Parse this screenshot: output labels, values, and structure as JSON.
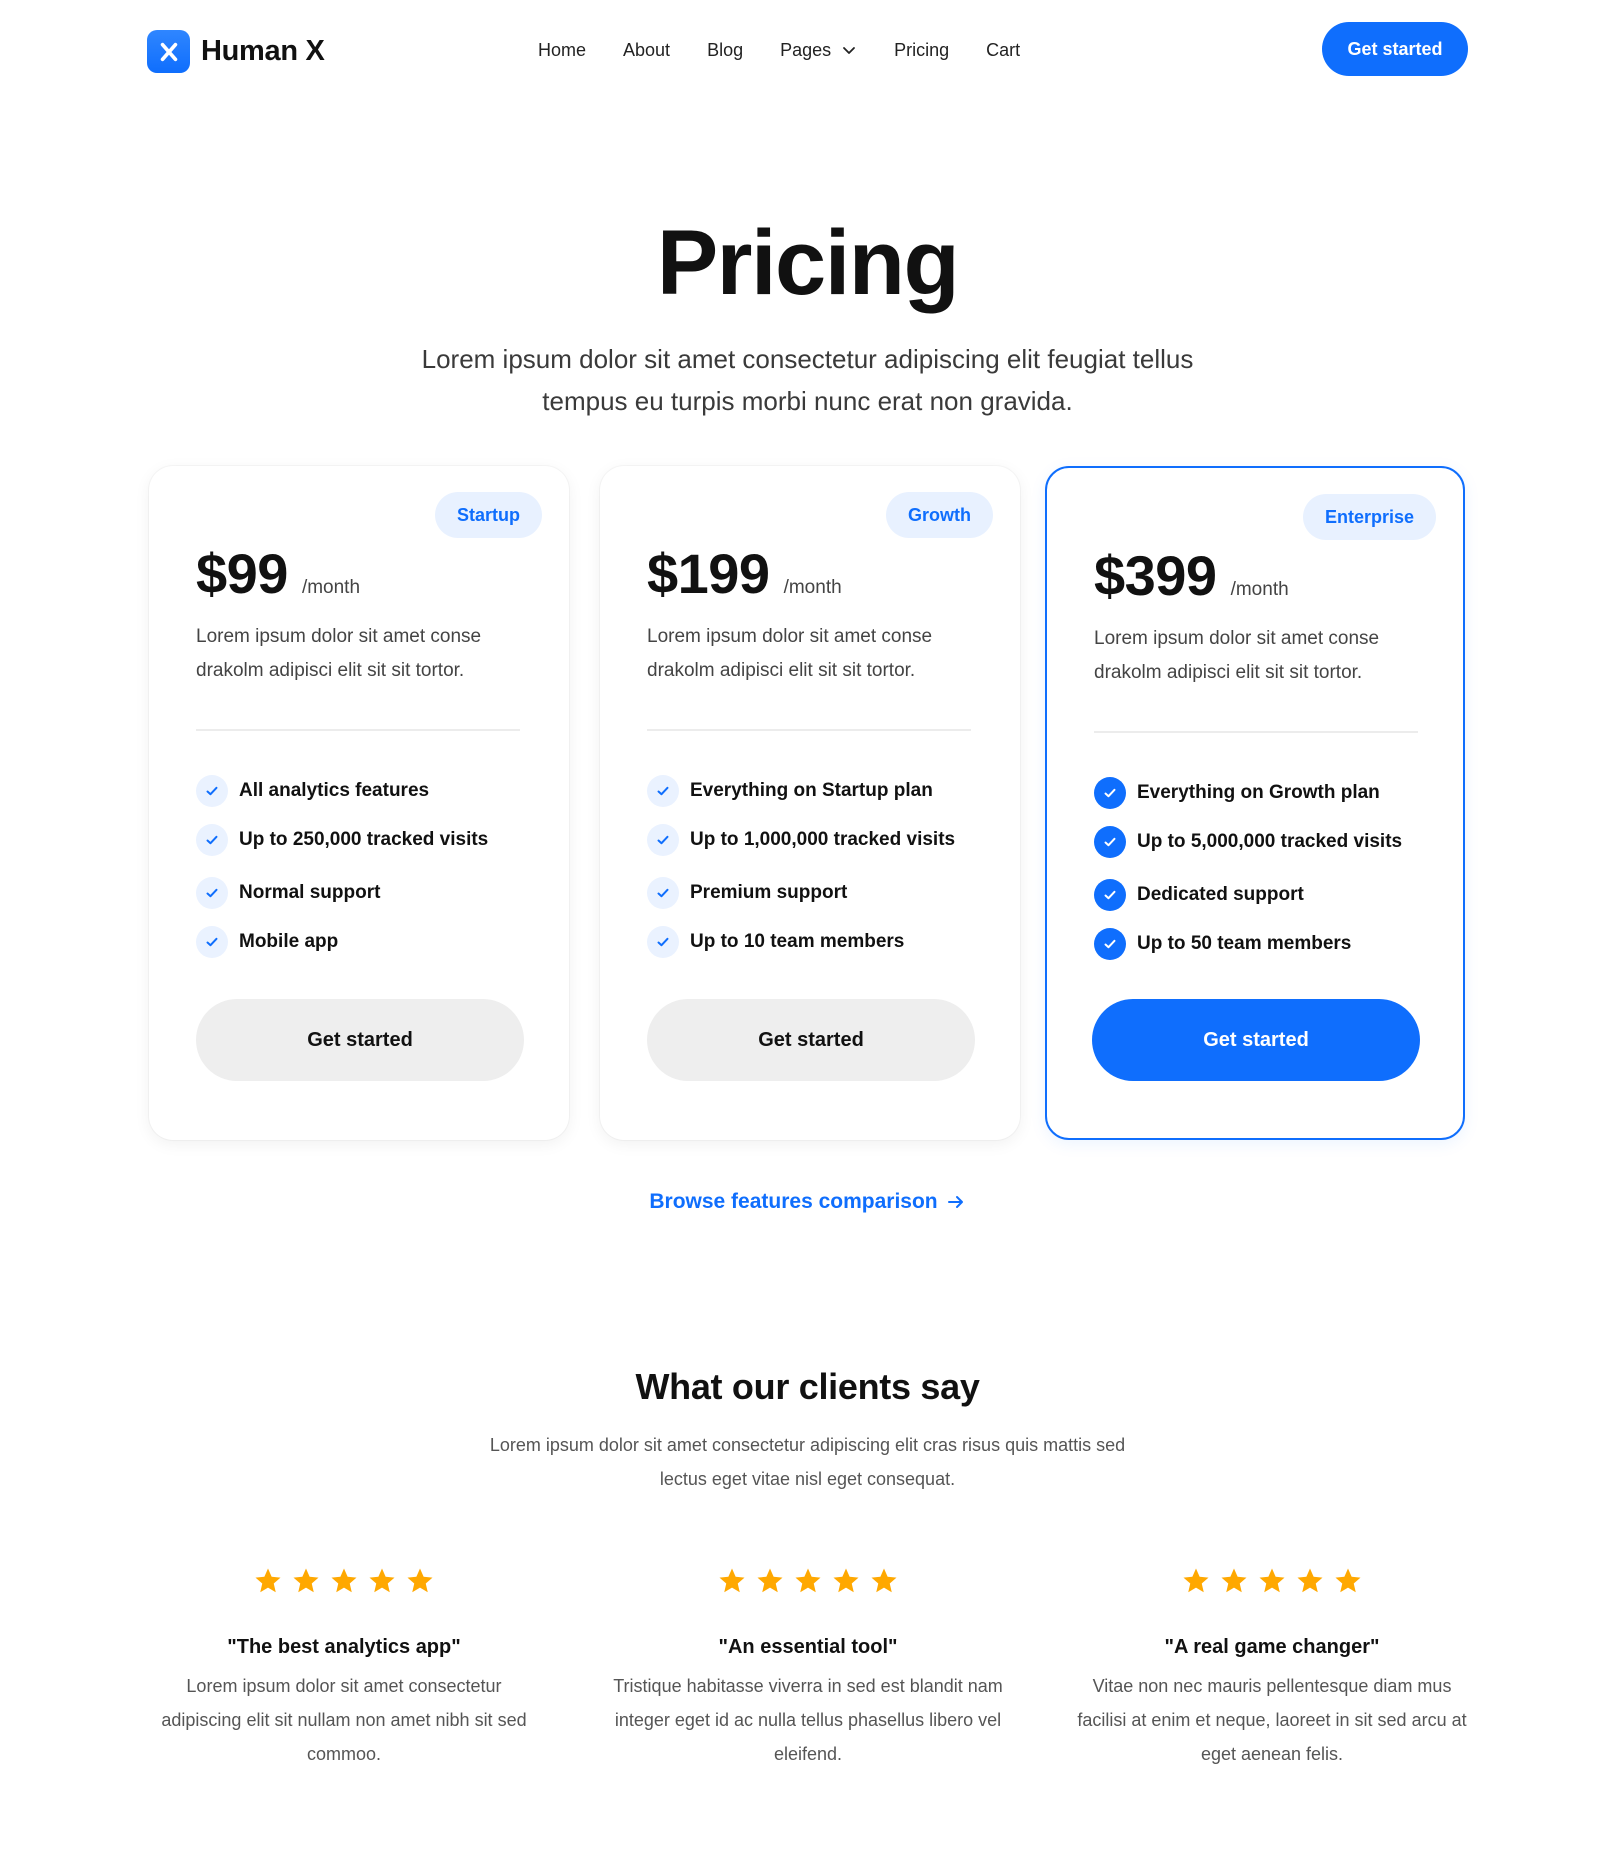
{
  "header": {
    "brand": "Human X",
    "brand_icon": "x-logo-icon",
    "nav": [
      {
        "label": "Home"
      },
      {
        "label": "About"
      },
      {
        "label": "Blog"
      },
      {
        "label": "Pages",
        "has_dropdown": true
      },
      {
        "label": "Pricing"
      },
      {
        "label": "Cart"
      }
    ],
    "cta_label": "Get started"
  },
  "hero": {
    "title": "Pricing",
    "subtitle": "Lorem ipsum dolor sit amet consectetur adipiscing elit feugiat tellus tempus eu turpis morbi nunc erat non gravida."
  },
  "plans": [
    {
      "badge": "Startup",
      "price": "$99",
      "period": "/month",
      "description": "Lorem ipsum dolor sit amet conse drakolm adipisci elit sit sit tortor.",
      "features": [
        "All analytics features",
        "Up to 250,000 tracked visits",
        "Normal support",
        "Mobile app"
      ],
      "button_label": "Get started",
      "highlighted": false
    },
    {
      "badge": "Growth",
      "price": "$199",
      "period": "/month",
      "description": "Lorem ipsum dolor sit amet conse drakolm adipisci elit sit sit tortor.",
      "features": [
        "Everything on Startup plan",
        "Up to 1,000,000 tracked visits",
        "Premium support",
        "Up to 10 team members"
      ],
      "button_label": "Get started",
      "highlighted": false
    },
    {
      "badge": "Enterprise",
      "price": "$399",
      "period": "/month",
      "description": "Lorem ipsum dolor sit amet conse drakolm adipisci elit sit sit tortor.",
      "features": [
        "Everything on Growth plan",
        "Up to 5,000,000 tracked visits",
        "Dedicated support",
        "Up to 50 team members"
      ],
      "button_label": "Get started",
      "highlighted": true
    }
  ],
  "compare_link": "Browse features comparison",
  "testimonials": {
    "title": "What our clients say",
    "subtitle": "Lorem ipsum dolor sit amet consectetur adipiscing elit cras risus quis mattis sed lectus eget vitae nisl eget consequat.",
    "items": [
      {
        "rating": 5,
        "max_rating": 5,
        "quote": "\"The best analytics app\"",
        "body": "Lorem ipsum dolor sit amet consectetur adipiscing elit sit nullam non amet nibh sit sed commoo."
      },
      {
        "rating": 5,
        "max_rating": 5,
        "quote": "\"An essential tool\"",
        "body": "Tristique habitasse viverra in sed est blandit nam integer eget id ac nulla tellus phasellus libero vel eleifend."
      },
      {
        "rating": 5,
        "max_rating": 5,
        "quote": "\"A real game changer\"",
        "body": "Vitae non nec mauris pellentesque diam mus facilisi at enim et neque, laoreet in sit sed arcu at eget aenean felis."
      }
    ]
  },
  "colors": {
    "accent": "#0f6efd",
    "badge_bg": "#e8f1ff",
    "star": "#ffa800",
    "secondary_button_bg": "#eeeeee"
  }
}
